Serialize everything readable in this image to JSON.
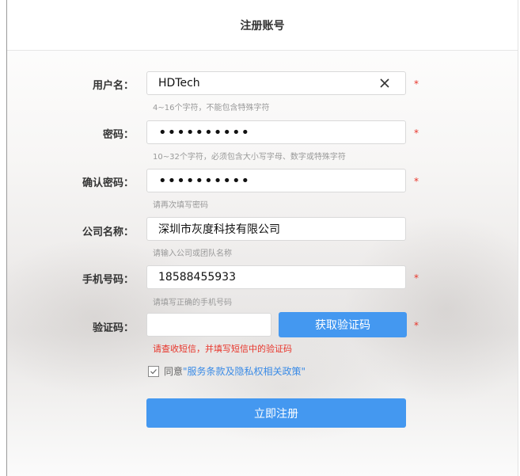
{
  "header": {
    "title": "注册账号"
  },
  "form": {
    "username": {
      "label": "用户名：",
      "value": "HDTech",
      "hint": "4~16个字符，不能包含特殊字符"
    },
    "password": {
      "label": "密码：",
      "value": "••••••••••",
      "hint": "10~32个字符，必须包含大小写字母、数字或特殊字符"
    },
    "confirm": {
      "label": "确认密码：",
      "value": "••••••••••",
      "hint": "请再次填写密码"
    },
    "company": {
      "label": "公司名称：",
      "value": "深圳市灰度科技有限公司",
      "hint": "请输入公司或团队名称"
    },
    "phone": {
      "label": "手机号码：",
      "value": "18588455933",
      "hint": "请填写正确的手机号码"
    },
    "code": {
      "label": "验证码：",
      "value": "",
      "button": "获取验证码",
      "hint": "请查收短信，并填写短信中的验证码"
    },
    "required_mark": "*"
  },
  "agreement": {
    "checked": true,
    "prefix": "同意",
    "link": "\"服务条款及隐私权相关政策\""
  },
  "submit": {
    "label": "立即注册"
  },
  "colors": {
    "accent": "#4498f0",
    "error": "#e8352b",
    "link": "#3a8be6"
  },
  "icons": {
    "clear": "close-icon",
    "check": "checkmark-icon"
  }
}
